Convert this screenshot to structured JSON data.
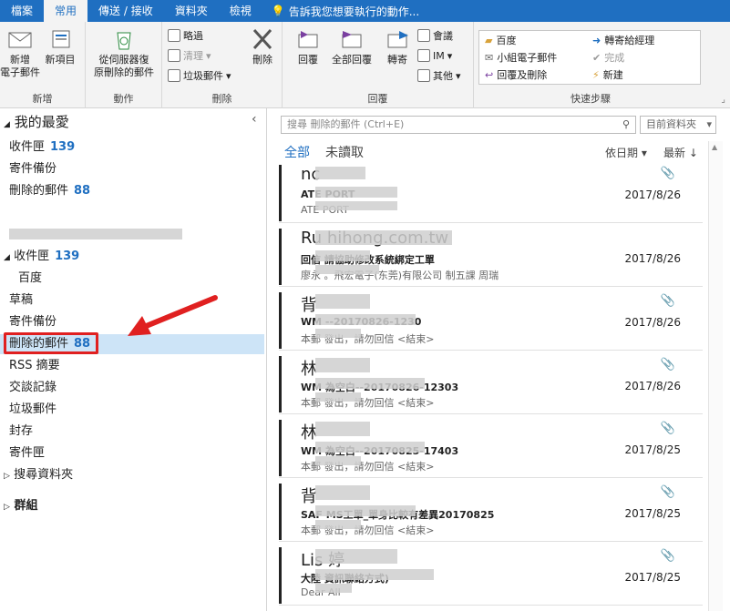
{
  "tabs": [
    "檔案",
    "常用",
    "傳送 / 接收",
    "資料夾",
    "檢視"
  ],
  "tell_me": "告訴我您想要執行的動作...",
  "ribbon": {
    "new_email": "新增\n電子郵件",
    "new_items": "新項目",
    "group_new": "新增",
    "restore": "從伺服器復\n原刪除的郵件",
    "group_actions": "動作",
    "ignore": "略過",
    "cleanup": "清理",
    "junk": "垃圾郵件",
    "delete": "刪除",
    "group_delete": "刪除",
    "reply": "回覆",
    "reply_all": "全部回覆",
    "forward": "轉寄",
    "meeting": "會議",
    "im": "IM",
    "more": "其他",
    "group_respond": "回覆",
    "quick_steps": [
      "百度",
      "轉寄給經理",
      "小組電子郵件",
      "完成",
      "回覆及刪除",
      "新建"
    ],
    "group_quick": "快速步驟"
  },
  "folders": {
    "favorites": "我的最愛",
    "fav_items": [
      {
        "label": "收件匣",
        "count": "139"
      },
      {
        "label": "寄件備份",
        "count": ""
      },
      {
        "label": "刪除的郵件",
        "count": "88"
      }
    ],
    "account_items": [
      {
        "label": "收件匣",
        "count": "139"
      },
      {
        "label": "百度",
        "count": ""
      },
      {
        "label": "草稿",
        "count": ""
      },
      {
        "label": "寄件備份",
        "count": ""
      },
      {
        "label": "刪除的郵件",
        "count": "88"
      },
      {
        "label": "RSS 摘要",
        "count": ""
      },
      {
        "label": "交談記錄",
        "count": ""
      },
      {
        "label": "垃圾郵件",
        "count": ""
      },
      {
        "label": "封存",
        "count": ""
      },
      {
        "label": "寄件匣",
        "count": ""
      },
      {
        "label": "搜尋資料夾",
        "count": ""
      }
    ],
    "groups": "群組"
  },
  "list": {
    "search_placeholder": "搜尋 刪除的郵件 (Ctrl+E)",
    "scope": "目前資料夾",
    "filter_all": "全部",
    "filter_unread": "未讀取",
    "sort_by": "依日期",
    "order": "最新",
    "mails": [
      {
        "sender": "nc",
        "subject": "ATE                  PORT",
        "preview": "ATE                  PORT",
        "date": "2017/8/26",
        "attach": true
      },
      {
        "sender": "Ru                hihong.com.tw",
        "subject": "回信          請協助修改系統綁定工單",
        "preview": "廖永     。飛宏電子(东莞)有限公司 制五課 周瑞",
        "date": "2017/8/26",
        "attach": false
      },
      {
        "sender": "背",
        "subject": "WM                    --20170826-1230",
        "preview": "本郵        發出，請勿回信 <結束>",
        "date": "2017/8/26",
        "attach": true
      },
      {
        "sender": "林",
        "subject": "WM                  為空白--20170826-12303",
        "preview": "本郵        發出，請勿回信 <結束>",
        "date": "2017/8/26",
        "attach": true
      },
      {
        "sender": "林",
        "subject": "WM                  為空白--20170825-17403",
        "preview": "本郵        發出，請勿回信 <結束>",
        "date": "2017/8/25",
        "attach": true
      },
      {
        "sender": "背",
        "subject": "SAF               MS工單_單身比較有差異20170825",
        "preview": "本郵        發出，請勿回信 <結束>",
        "date": "2017/8/25",
        "attach": true
      },
      {
        "sender": "Lis              婷",
        "subject": "大陸              資訊聯絡方式)",
        "preview": "Dear All",
        "date": "2017/8/25",
        "attach": true
      }
    ]
  },
  "colors": {
    "accent": "#1f6fc1",
    "highlight": "#cde4f7",
    "arrow": "#e02020"
  }
}
